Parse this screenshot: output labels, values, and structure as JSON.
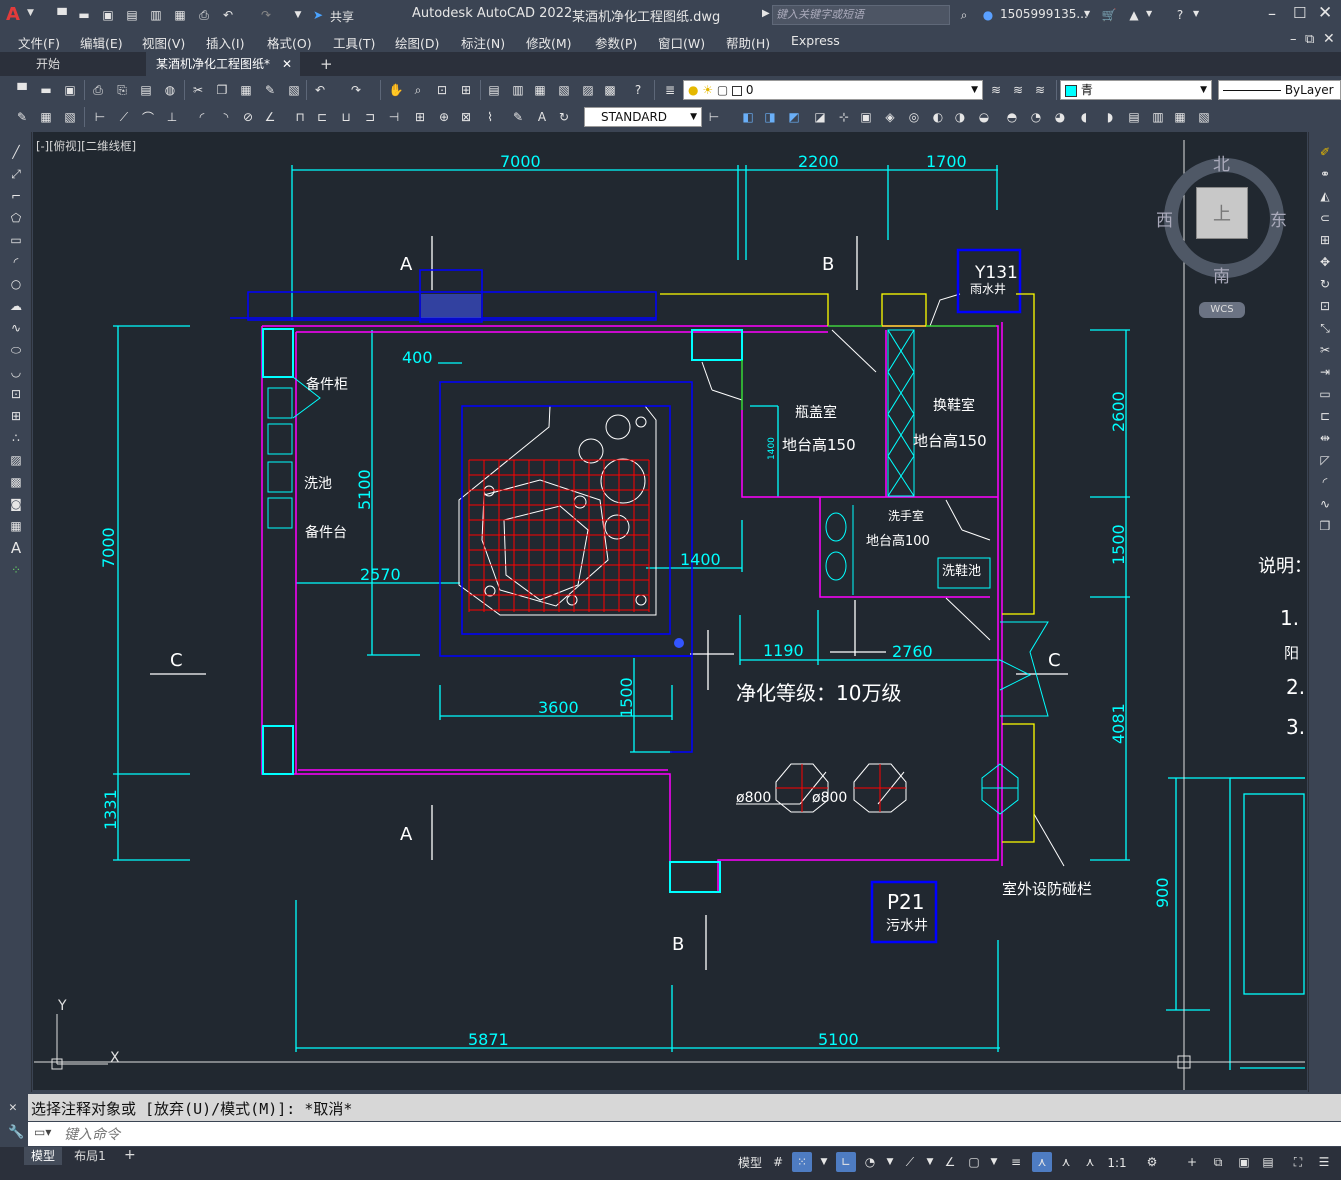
{
  "title_bar": {
    "app_title": "Autodesk AutoCAD 2022",
    "file_name": "某酒机净化工程图纸.dwg",
    "share_label": "共享",
    "search_placeholder": "键入关键字或短语",
    "user_name": "1505999135...",
    "app_letter": "A"
  },
  "menu": [
    "文件(F)",
    "编辑(E)",
    "视图(V)",
    "插入(I)",
    "格式(O)",
    "工具(T)",
    "绘图(D)",
    "标注(N)",
    "修改(M)",
    "参数(P)",
    "窗口(W)",
    "帮助(H)",
    "Express"
  ],
  "tabs": [
    {
      "label": "开始",
      "active": false
    },
    {
      "label": "某酒机净化工程图纸*",
      "active": true
    }
  ],
  "toolbar": {
    "layer_value": "0",
    "color_value": "青",
    "linetype_value": "ByLayer",
    "textstyle_value": "STANDARD"
  },
  "viewport": {
    "label": "[-][俯视][二维线框]",
    "axis_y": "Y",
    "axis_x": "X"
  },
  "viewcube": {
    "north": "北",
    "south": "南",
    "east": "东",
    "west": "西",
    "top": "上",
    "wcs": "WCS"
  },
  "drawing": {
    "dims": [
      "7000",
      "2200",
      "1700",
      "400",
      "5100",
      "2570",
      "1400",
      "3600",
      "1500",
      "1190",
      "2760",
      "2600",
      "1500",
      "4081",
      "7000",
      "1331",
      "900",
      "5871",
      "5100",
      "1400"
    ],
    "rooms": [
      "备件柜",
      "洗池",
      "备件台",
      "瓶盖室",
      "地台高150",
      "换鞋室",
      "地台高150",
      "洗手室",
      "地台高100",
      "洗鞋池"
    ],
    "section_marks": [
      "A",
      "B",
      "C",
      "A",
      "B",
      "C"
    ],
    "tag_y": "Y131",
    "tag_y_sub": "雨水井",
    "tag_p": "P21",
    "tag_p_sub": "污水井",
    "grade_text": "净化等级：10万级",
    "pipe1": "ø800",
    "pipe2": "ø800",
    "outdoor_note": "室外设防碰栏",
    "notes_title": "说明：",
    "notes": [
      "1.",
      "阳",
      "2.",
      "3."
    ]
  },
  "command": {
    "history": "选择注释对象或 [放弃(U)/模式(M)]: *取消*",
    "placeholder": "键入命令"
  },
  "status": {
    "layout_tabs": [
      "模型",
      "布局1"
    ],
    "model_label": "模型",
    "scale": "1:1"
  },
  "colors": {
    "cyan": "#00ffff",
    "magenta": "#ff00ff",
    "blue": "#0000ff",
    "red": "#ff0000",
    "yellow": "#ffff00",
    "green": "#00ff00",
    "white": "#ffffff",
    "bg": "#212830"
  }
}
